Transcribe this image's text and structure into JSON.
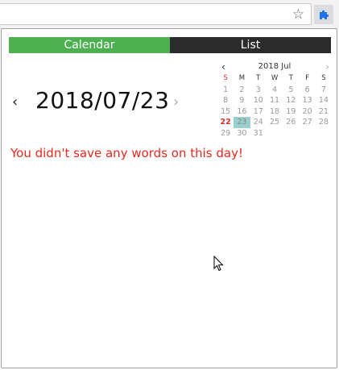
{
  "colors": {
    "accent_green": "#4caf50",
    "tab_dark": "#2b2b2b",
    "error_red": "#e8291c",
    "selected_day": "#9acfcf"
  },
  "toolbar": {
    "star_icon": "star-icon",
    "extension_icon": "puzzle-piece-icon"
  },
  "tabs": {
    "calendar": "Calendar",
    "list": "List"
  },
  "day_view": {
    "prev_symbol": "‹",
    "next_symbol": "›",
    "date": "2018/07/23",
    "message": "You didn't save any words on this day!"
  },
  "mini_calendar": {
    "prev_symbol": "‹",
    "next_symbol": "›",
    "title": "2018 Jul",
    "weekdays": [
      "S",
      "M",
      "T",
      "W",
      "T",
      "F",
      "S"
    ],
    "weeks": [
      [
        "1",
        "2",
        "3",
        "4",
        "5",
        "6",
        "7"
      ],
      [
        "8",
        "9",
        "10",
        "11",
        "12",
        "13",
        "14"
      ],
      [
        "15",
        "16",
        "17",
        "18",
        "19",
        "20",
        "21"
      ],
      [
        "22",
        "23",
        "24",
        "25",
        "26",
        "27",
        "28"
      ],
      [
        "29",
        "30",
        "31",
        "",
        "",
        "",
        ""
      ]
    ],
    "today": "22",
    "selected": "23"
  }
}
